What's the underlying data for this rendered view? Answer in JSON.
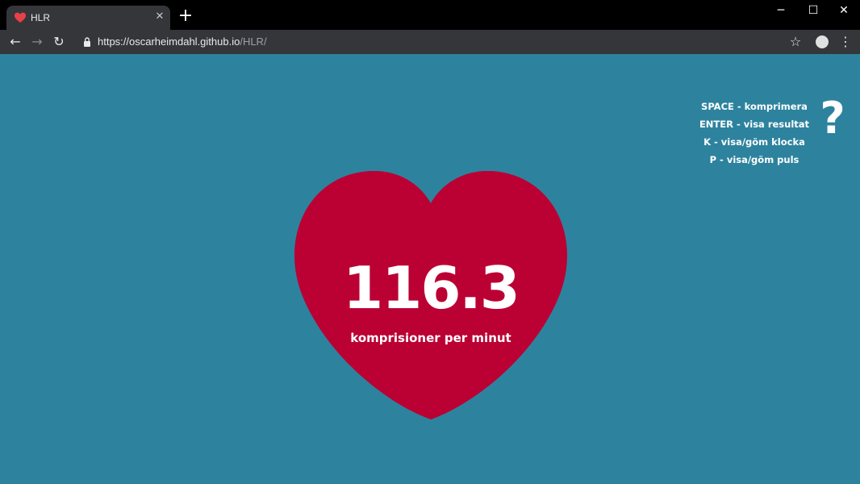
{
  "browser": {
    "tab_title": "HLR",
    "url_host": "https://oscarheimdahl.github.io",
    "url_path": "/HLR/"
  },
  "main": {
    "compressions_value": "116.3",
    "compressions_unit": "komprisioner per minut"
  },
  "help": {
    "icon_glyph": "?",
    "shortcuts": [
      "SPACE - komprimera",
      "ENTER - visa resultat",
      "K - visa/göm klocka",
      "P - visa/göm puls"
    ]
  },
  "colors": {
    "background": "#2d839e",
    "heart": "#bb0033",
    "text": "#ffffff"
  }
}
